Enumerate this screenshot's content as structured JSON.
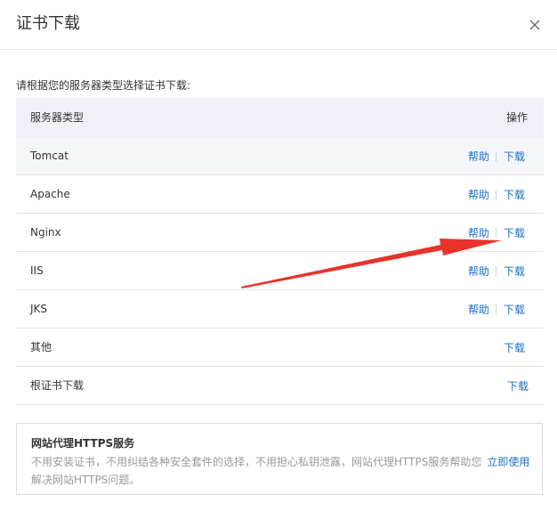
{
  "dialog": {
    "title": "证书下载",
    "close_icon": "close-icon"
  },
  "intro": "请根据您的服务器类型选择证书下载:",
  "table": {
    "headers": {
      "type": "服务器类型",
      "ops": "操作"
    },
    "rows": [
      {
        "name": "Tomcat",
        "help": "帮助",
        "download": "下载"
      },
      {
        "name": "Apache",
        "help": "帮助",
        "download": "下载"
      },
      {
        "name": "Nginx",
        "help": "帮助",
        "download": "下载"
      },
      {
        "name": "IIS",
        "help": "帮助",
        "download": "下载"
      },
      {
        "name": "JKS",
        "help": "帮助",
        "download": "下载"
      },
      {
        "name": "其他",
        "download": "下载"
      },
      {
        "name": "根证书下载",
        "download": "下载"
      }
    ]
  },
  "promo": {
    "title": "网站代理HTTPS服务",
    "description_line1": "不用安装证书，不用纠结各种安全套件的选择，不用担心私钥泄露，网站代理HTTPS服务帮助您",
    "description_line2": "解决网站HTTPS问题。",
    "link": "立即使用"
  },
  "colors": {
    "link": "#1a6fc6",
    "header_bg": "#eef1f5",
    "arrow": "#e8322b"
  }
}
